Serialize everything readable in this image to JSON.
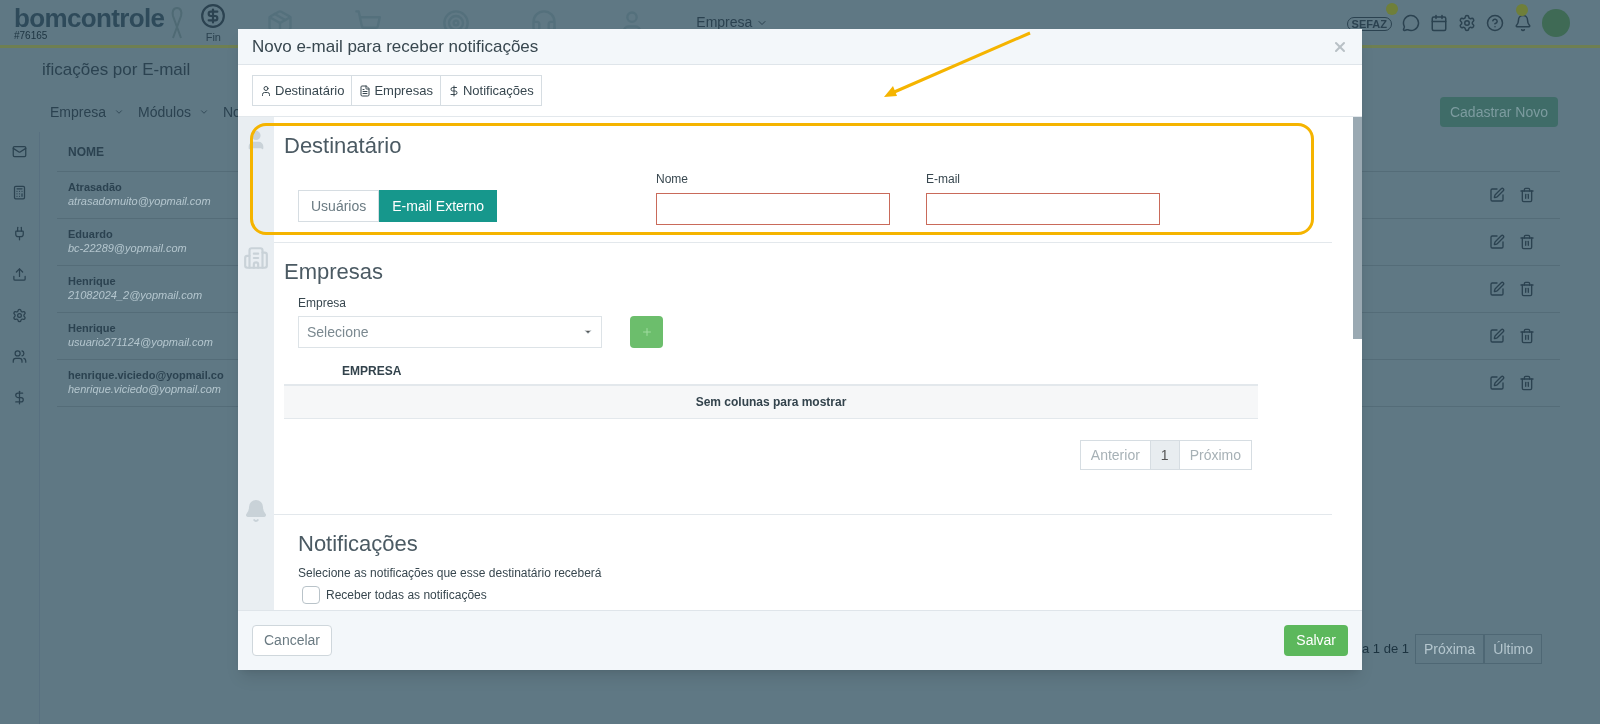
{
  "app": {
    "logo": "bomcontrole",
    "account_id": "#76165",
    "nav_label": "Fin",
    "company_menu": "Empresa",
    "sefaz_badge": "SEFAZ"
  },
  "page": {
    "title": "ificações por E-mail",
    "filters": [
      "Empresa",
      "Módulos",
      "No"
    ],
    "new_button": "Cadastrar Novo",
    "column": "NOME",
    "rows": [
      {
        "name": "Atrasadão",
        "email": "atrasadomuito@yopmail.com"
      },
      {
        "name": "Eduardo",
        "email": "bc-22289@yopmail.com"
      },
      {
        "name": "Henrique",
        "email": "21082024_2@yopmail.com"
      },
      {
        "name": "Henrique",
        "email": "usuario271124@yopmail.com"
      },
      {
        "name": "henrique.viciedo@yopmail.co",
        "email": "henrique.viciedo@yopmail.com"
      }
    ],
    "pagination": {
      "info": "a 1 de 1",
      "buttons": [
        "Próxima",
        "Último"
      ]
    }
  },
  "modal": {
    "title": "Novo e-mail para receber notificações",
    "tabs": [
      {
        "label": "Destinatário",
        "selected": false
      },
      {
        "label": "Empresas",
        "selected": false
      },
      {
        "label": "Notificações",
        "selected": false
      }
    ],
    "recipient": {
      "heading": "Destinatário",
      "options": [
        {
          "label": "Usuários",
          "selected": false
        },
        {
          "label": "E-mail Externo",
          "selected": true
        }
      ],
      "fields": [
        {
          "label": "Nome",
          "invalid": true
        },
        {
          "label": "E-mail",
          "invalid": true
        }
      ]
    },
    "companies": {
      "heading": "Empresas",
      "field_label": "Empresa",
      "placeholder": "Selecione",
      "column": "EMPRESA",
      "empty": "Sem colunas para mostrar",
      "pages": [
        {
          "label": "Anterior",
          "selected": false
        },
        {
          "label": "1",
          "selected": true
        },
        {
          "label": "Próximo",
          "selected": false
        }
      ]
    },
    "notifications": {
      "heading": "Notificações",
      "description": "Selecione as notificações que esse destinatário receberá",
      "checkbox": {
        "label": "Receber todas as notificações",
        "checked": false
      }
    },
    "footer": {
      "cancel": "Cancelar",
      "save": "Salvar"
    }
  }
}
